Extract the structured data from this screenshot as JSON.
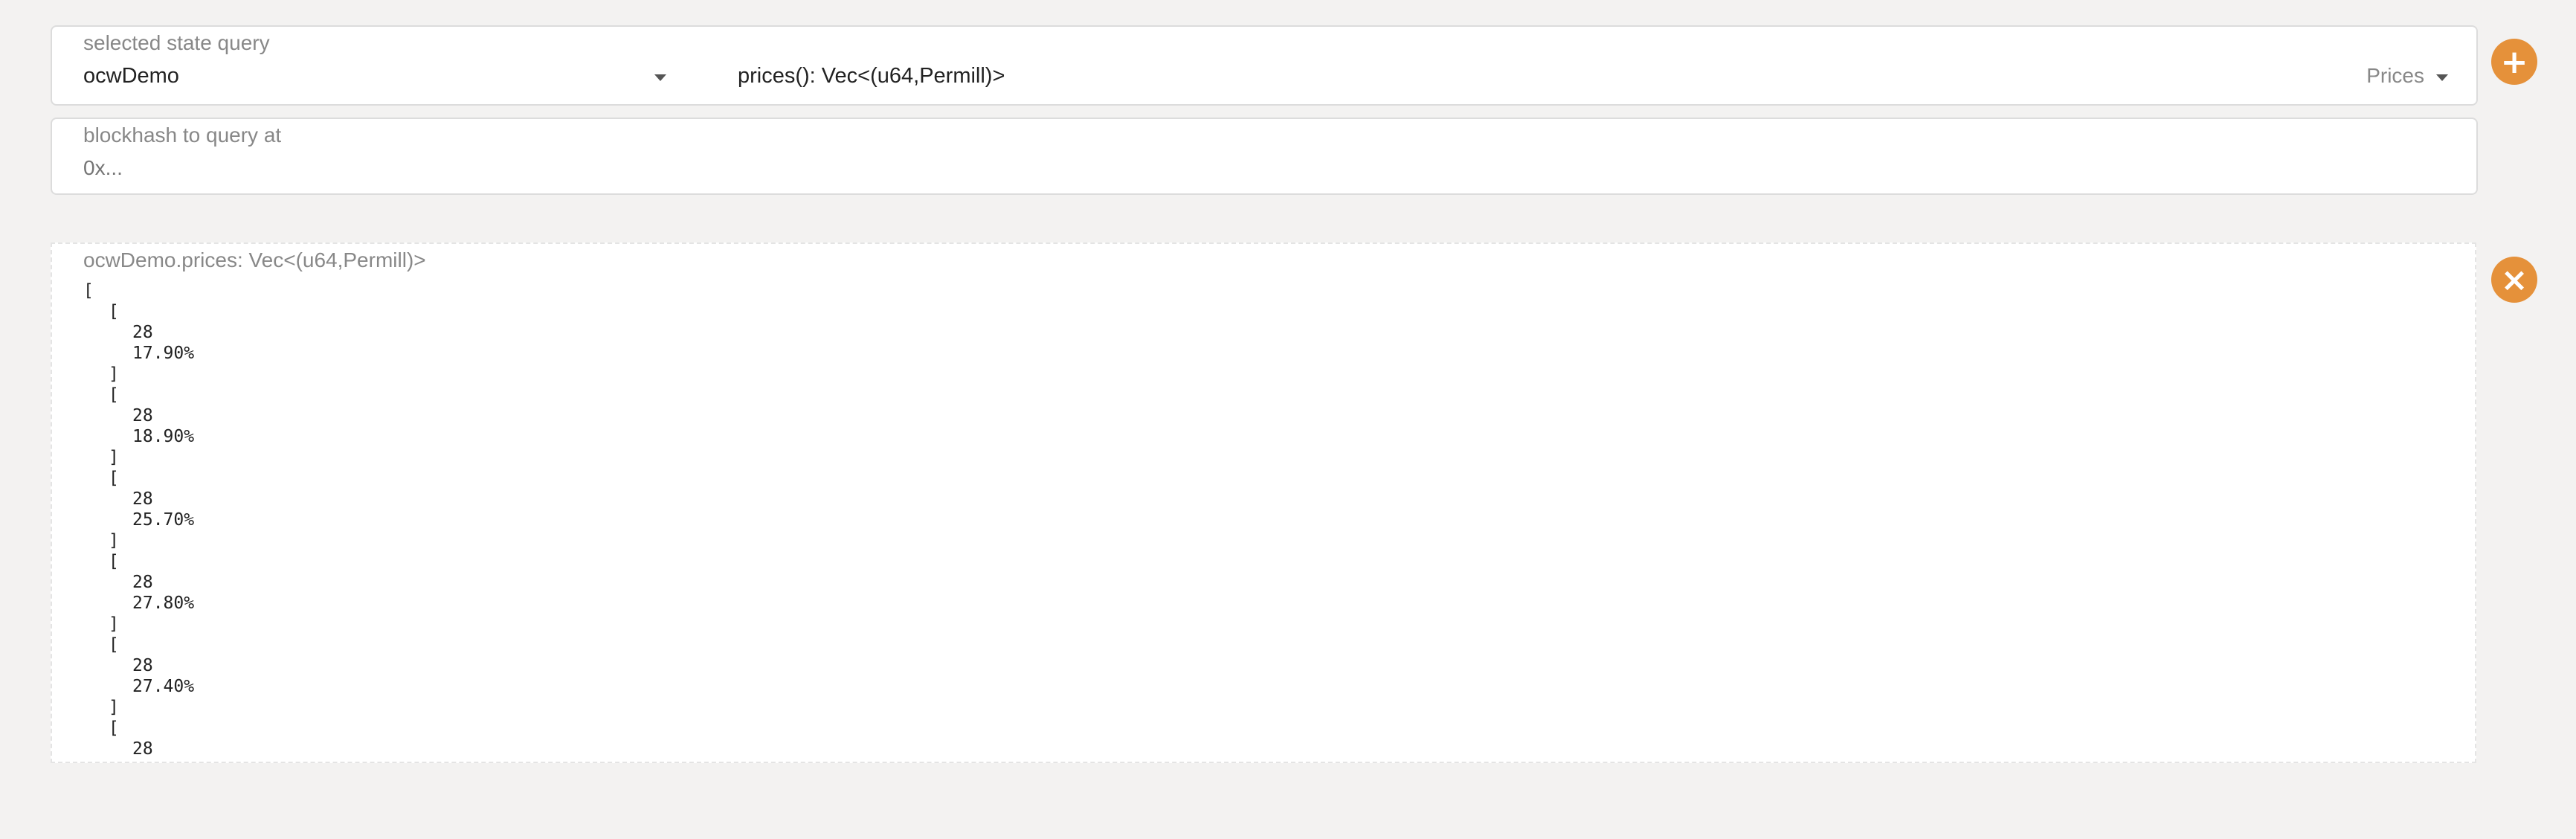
{
  "query": {
    "label": "selected state query",
    "module": "ocwDemo",
    "method": "prices(): Vec<(u64,Permill)>",
    "method_doc": "Prices"
  },
  "blockhash": {
    "label": "blockhash to query at",
    "placeholder": "0x..."
  },
  "result": {
    "header": "ocwDemo.prices: Vec<(u64,Permill)>",
    "lines": [
      "[",
      "[",
      "28",
      "17.90%",
      "]",
      "[",
      "28",
      "18.90%",
      "]",
      "[",
      "28",
      "25.70%",
      "]",
      "[",
      "28",
      "27.80%",
      "]",
      "[",
      "28",
      "27.40%",
      "]",
      "[",
      "28"
    ]
  },
  "buttons": {
    "add_glyph": "+",
    "close_glyph": "×"
  },
  "colors": {
    "accent": "#e5913a",
    "background": "#f3f2f1",
    "card": "#ffffff",
    "muted_text": "#888888"
  },
  "icons": [
    "plus-icon",
    "close-icon",
    "chevron-down-icon"
  ]
}
